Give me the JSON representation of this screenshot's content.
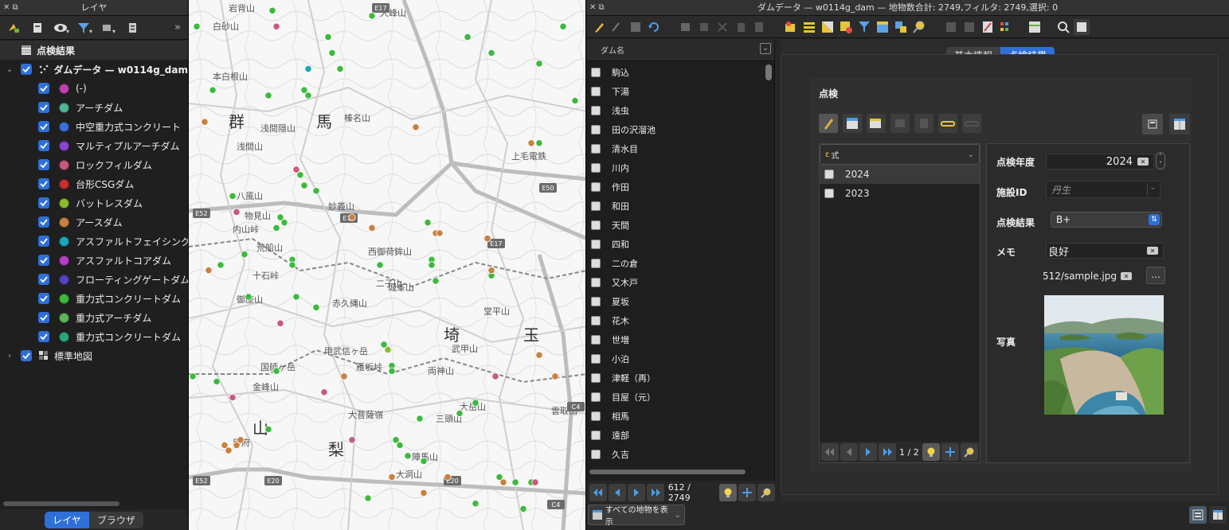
{
  "layers_panel": {
    "title": "レイヤ",
    "root_group": "点検結果",
    "layer_name": "ダムデータ — w0114g_dam",
    "categories": [
      {
        "label": "(-)",
        "color": "#c03fb0"
      },
      {
        "label": "アーチダム",
        "color": "#4fb79a"
      },
      {
        "label": "中空重力式コンクリート",
        "color": "#3b6fd8"
      },
      {
        "label": "マルティプルアーチダム",
        "color": "#8a44d0"
      },
      {
        "label": "ロックフィルダム",
        "color": "#c85a7a"
      },
      {
        "label": "台形CSGダム",
        "color": "#c73030"
      },
      {
        "label": "バットレスダム",
        "color": "#8cbb2a"
      },
      {
        "label": "アースダム",
        "color": "#c9813f"
      },
      {
        "label": "アスファルトフェイシング",
        "color": "#1ea7b6"
      },
      {
        "label": "アスファルトコアダム",
        "color": "#b53ec4"
      },
      {
        "label": "フローティングゲートダム",
        "color": "#5244c5"
      },
      {
        "label": "重力式コンクリートダム",
        "color": "#3dba3d"
      },
      {
        "label": "重力式アーチダム",
        "color": "#5fb35f"
      },
      {
        "label": "重力式コンクリートダム",
        "color": "#2aa67a"
      }
    ],
    "basemap_layer": "標準地図",
    "tab_layers": "レイヤ",
    "tab_browser": "ブラウザ"
  },
  "map": {
    "place_labels": [
      "岩背山",
      "大峰山",
      "群",
      "馬",
      "榛名山",
      "浅間隠山",
      "浅間山",
      "妙義山",
      "物見山",
      "荒船山",
      "西御荷鉾山",
      "御座山",
      "赤久縄山",
      "城峯山",
      "埼",
      "玉",
      "武甲山",
      "堂平山",
      "甲武信ヶ岳",
      "国師ヶ岳",
      "金峰山",
      "雲取山",
      "大菩薩嶺",
      "三頭山",
      "大岳山",
      "山",
      "梨",
      "陣馬山",
      "甲府",
      "上毛電鉄",
      "八風山",
      "内山峠",
      "十石峠",
      "二子山",
      "両神山",
      "雁坂峠",
      "大洞山",
      "白砂山",
      "本白根山"
    ],
    "road_labels": [
      "E17",
      "E50",
      "E52",
      "E18",
      "E17",
      "C4",
      "E20",
      "E52",
      "E20",
      "C4"
    ],
    "points": [
      {
        "x": 0.21,
        "y": 0.02,
        "c": "#3dba3d"
      },
      {
        "x": 0.46,
        "y": 0.03,
        "c": "#3dba3d"
      },
      {
        "x": 0.02,
        "y": 0.05,
        "c": "#3dba3d"
      },
      {
        "x": 0.22,
        "y": 0.05,
        "c": "#c85a7a"
      },
      {
        "x": 0.35,
        "y": 0.07,
        "c": "#3dba3d"
      },
      {
        "x": 0.7,
        "y": 0.07,
        "c": "#3dba3d"
      },
      {
        "x": 0.94,
        "y": 0.05,
        "c": "#3dba3d"
      },
      {
        "x": 0.36,
        "y": 0.1,
        "c": "#3dba3d"
      },
      {
        "x": 0.38,
        "y": 0.13,
        "c": "#3dba3d"
      },
      {
        "x": 0.76,
        "y": 0.1,
        "c": "#3dba3d"
      },
      {
        "x": 0.88,
        "y": 0.12,
        "c": "#3dba3d"
      },
      {
        "x": 0.3,
        "y": 0.13,
        "c": "#1ea7b6"
      },
      {
        "x": 0.29,
        "y": 0.17,
        "c": "#3dba3d"
      },
      {
        "x": 0.3,
        "y": 0.18,
        "c": "#3dba3d"
      },
      {
        "x": 0.2,
        "y": 0.18,
        "c": "#3dba3d"
      },
      {
        "x": 0.06,
        "y": 0.17,
        "c": "#3dba3d"
      },
      {
        "x": 0.97,
        "y": 0.19,
        "c": "#3dba3d"
      },
      {
        "x": 0.04,
        "y": 0.23,
        "c": "#c9813f"
      },
      {
        "x": 0.57,
        "y": 0.24,
        "c": "#c9813f"
      },
      {
        "x": 0.86,
        "y": 0.27,
        "c": "#c9813f"
      },
      {
        "x": 0.88,
        "y": 0.27,
        "c": "#3dba3d"
      },
      {
        "x": 0.27,
        "y": 0.32,
        "c": "#c85a7a"
      },
      {
        "x": 0.28,
        "y": 0.33,
        "c": "#3dba3d"
      },
      {
        "x": 0.29,
        "y": 0.35,
        "c": "#3dba3d"
      },
      {
        "x": 0.32,
        "y": 0.36,
        "c": "#3dba3d"
      },
      {
        "x": 0.11,
        "y": 0.37,
        "c": "#3dba3d"
      },
      {
        "x": 0.12,
        "y": 0.4,
        "c": "#c85a7a"
      },
      {
        "x": 0.23,
        "y": 0.41,
        "c": "#3dba3d"
      },
      {
        "x": 0.22,
        "y": 0.43,
        "c": "#3dba3d"
      },
      {
        "x": 0.24,
        "y": 0.42,
        "c": "#3dba3d"
      },
      {
        "x": 0.41,
        "y": 0.41,
        "c": "#c9813f"
      },
      {
        "x": 0.46,
        "y": 0.43,
        "c": "#c9813f"
      },
      {
        "x": 0.6,
        "y": 0.42,
        "c": "#3dba3d"
      },
      {
        "x": 0.62,
        "y": 0.44,
        "c": "#c9813f"
      },
      {
        "x": 0.63,
        "y": 0.44,
        "c": "#c9813f"
      },
      {
        "x": 0.75,
        "y": 0.45,
        "c": "#c9813f"
      },
      {
        "x": 0.14,
        "y": 0.48,
        "c": "#3dba3d"
      },
      {
        "x": 0.26,
        "y": 0.49,
        "c": "#3dba3d"
      },
      {
        "x": 0.61,
        "y": 0.49,
        "c": "#3dba3d"
      },
      {
        "x": 0.26,
        "y": 0.5,
        "c": "#3dba3d"
      },
      {
        "x": 0.08,
        "y": 0.5,
        "c": "#3dba3d"
      },
      {
        "x": 0.05,
        "y": 0.51,
        "c": "#c9813f"
      },
      {
        "x": 0.48,
        "y": 0.5,
        "c": "#3dba3d"
      },
      {
        "x": 0.61,
        "y": 0.5,
        "c": "#3dba3d"
      },
      {
        "x": 0.62,
        "y": 0.53,
        "c": "#3dba3d"
      },
      {
        "x": 0.76,
        "y": 0.52,
        "c": "#3dba3d"
      },
      {
        "x": 0.76,
        "y": 0.51,
        "c": "#c9813f"
      },
      {
        "x": 0.27,
        "y": 0.56,
        "c": "#3dba3d"
      },
      {
        "x": 0.15,
        "y": 0.56,
        "c": "#3dba3d"
      },
      {
        "x": 0.32,
        "y": 0.58,
        "c": "#3dba3d"
      },
      {
        "x": 0.23,
        "y": 0.61,
        "c": "#c85a7a"
      },
      {
        "x": 0.49,
        "y": 0.65,
        "c": "#3dba3d"
      },
      {
        "x": 0.5,
        "y": 0.66,
        "c": "#8cbb2a"
      },
      {
        "x": 0.88,
        "y": 0.67,
        "c": "#c9813f"
      },
      {
        "x": 0.01,
        "y": 0.71,
        "c": "#3dba3d"
      },
      {
        "x": 0.22,
        "y": 0.7,
        "c": "#3dba3d"
      },
      {
        "x": 0.39,
        "y": 0.71,
        "c": "#c9813f"
      },
      {
        "x": 0.51,
        "y": 0.69,
        "c": "#3dba3d"
      },
      {
        "x": 0.51,
        "y": 0.7,
        "c": "#3dba3d"
      },
      {
        "x": 0.92,
        "y": 0.71,
        "c": "#c9813f"
      },
      {
        "x": 0.07,
        "y": 0.72,
        "c": "#3dba3d"
      },
      {
        "x": 0.77,
        "y": 0.71,
        "c": "#c85a7a"
      },
      {
        "x": 0.34,
        "y": 0.74,
        "c": "#c85a7a"
      },
      {
        "x": 0.11,
        "y": 0.75,
        "c": "#c85a7a"
      },
      {
        "x": 0.72,
        "y": 0.76,
        "c": "#3dba3d"
      },
      {
        "x": 0.68,
        "y": 0.78,
        "c": "#3dba3d"
      },
      {
        "x": 0.58,
        "y": 0.79,
        "c": "#3dba3d"
      },
      {
        "x": 0.2,
        "y": 0.81,
        "c": "#3dba3d"
      },
      {
        "x": 0.41,
        "y": 0.83,
        "c": "#c85a7a"
      },
      {
        "x": 0.52,
        "y": 0.83,
        "c": "#3dba3d"
      },
      {
        "x": 0.12,
        "y": 0.84,
        "c": "#c9813f"
      },
      {
        "x": 0.13,
        "y": 0.83,
        "c": "#c9813f"
      },
      {
        "x": 0.09,
        "y": 0.84,
        "c": "#c9813f"
      },
      {
        "x": 0.1,
        "y": 0.85,
        "c": "#c9813f"
      },
      {
        "x": 0.53,
        "y": 0.84,
        "c": "#3dba3d"
      },
      {
        "x": 0.55,
        "y": 0.86,
        "c": "#3dba3d"
      },
      {
        "x": 0.59,
        "y": 0.87,
        "c": "#3dba3d"
      },
      {
        "x": 0.51,
        "y": 0.9,
        "c": "#c9813f"
      },
      {
        "x": 0.65,
        "y": 0.9,
        "c": "#c9813f"
      },
      {
        "x": 0.78,
        "y": 0.9,
        "c": "#3dba3d"
      },
      {
        "x": 0.79,
        "y": 0.91,
        "c": "#c9813f"
      },
      {
        "x": 0.82,
        "y": 0.91,
        "c": "#3dba3d"
      },
      {
        "x": 0.86,
        "y": 0.91,
        "c": "#3dba3d"
      },
      {
        "x": 0.87,
        "y": 0.91,
        "c": "#c85a7a"
      },
      {
        "x": 0.59,
        "y": 0.93,
        "c": "#c9813f"
      },
      {
        "x": 0.45,
        "y": 0.94,
        "c": "#3dba3d"
      },
      {
        "x": 0.84,
        "y": 0.96,
        "c": "#3dba3d"
      },
      {
        "x": 0.72,
        "y": 0.95,
        "c": "#3dba3d"
      }
    ]
  },
  "attribute_window": {
    "title": "ダムデータ — w0114g_dam — 地物数合計: 2749,フィルタ: 2749,選択: 0",
    "list_header": "ダム名",
    "dam_names": [
      "駒込",
      "下湯",
      "浅虫",
      "田の沢溜池",
      "清水目",
      "川内",
      "作田",
      "和田",
      "天間",
      "四和",
      "二の倉",
      "又木戸",
      "夏坂",
      "花木",
      "世増",
      "小泊",
      "津軽（再）",
      "目屋（元）",
      "相馬",
      "遠部",
      "久吉"
    ],
    "record_counter": "612 / 2749",
    "show_all_features": "すべての地物を表示",
    "tab_basic": "基本情報",
    "tab_inspection": "点検結果",
    "group_title": "点検",
    "expression_label": "式",
    "years": [
      "2024",
      "2023"
    ],
    "sub_counter": "1 / 2",
    "fields": {
      "year_label": "点検年度",
      "year_value": "2024",
      "facility_label": "施設ID",
      "facility_value": "丹生",
      "result_label": "点検結果",
      "result_value": "B+",
      "memo_label": "メモ",
      "memo_value": "良好",
      "path_value": "512/sample.jpg",
      "browse_label": "...",
      "photo_label": "写真"
    }
  }
}
